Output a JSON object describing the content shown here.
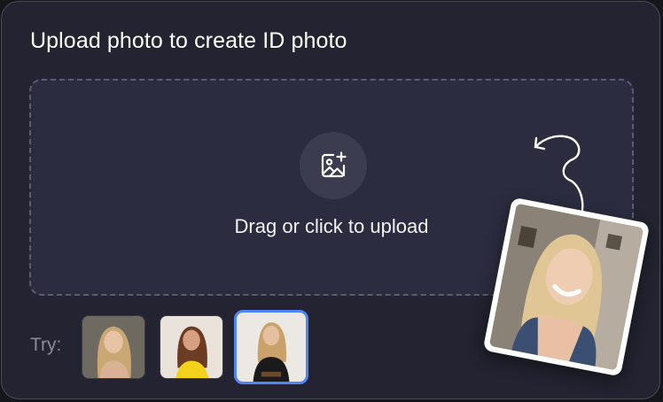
{
  "title": "Upload photo to create ID photo",
  "dropzone": {
    "label": "Drag or click to upload",
    "icon": "image-add-icon"
  },
  "samples": {
    "label": "Try:",
    "items": [
      {
        "name": "sample-1",
        "selected": false
      },
      {
        "name": "sample-2",
        "selected": false
      },
      {
        "name": "sample-3",
        "selected": true
      }
    ]
  },
  "colors": {
    "background": "#232331",
    "dropzone": "#2c2c40",
    "accent": "#4f86f7"
  }
}
